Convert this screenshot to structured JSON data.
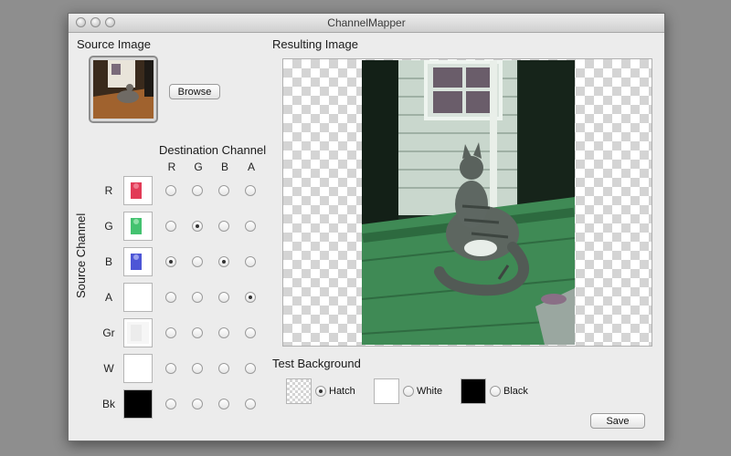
{
  "window": {
    "title": "ChannelMapper"
  },
  "source": {
    "label": "Source Image",
    "browse_label": "Browse"
  },
  "destination": {
    "label": "Destination Channel",
    "columns": [
      "R",
      "G",
      "B",
      "A"
    ]
  },
  "source_channel_label": "Source Channel",
  "rows": [
    {
      "label": "R",
      "swatch": "red-tint",
      "selected": [
        false,
        false,
        false,
        false
      ]
    },
    {
      "label": "G",
      "swatch": "green-tint",
      "selected": [
        false,
        true,
        false,
        false
      ]
    },
    {
      "label": "B",
      "swatch": "blue-tint",
      "selected": [
        true,
        false,
        true,
        false
      ]
    },
    {
      "label": "A",
      "swatch": "white",
      "selected": [
        false,
        false,
        false,
        true
      ]
    },
    {
      "label": "Gr",
      "swatch": "gray-faint",
      "selected": [
        false,
        false,
        false,
        false
      ]
    },
    {
      "label": "W",
      "swatch": "white",
      "selected": [
        false,
        false,
        false,
        false
      ]
    },
    {
      "label": "Bk",
      "swatch": "black",
      "selected": [
        false,
        false,
        false,
        false
      ]
    }
  ],
  "result": {
    "label": "Resulting Image"
  },
  "test_background": {
    "label": "Test Background",
    "options": [
      {
        "label": "Hatch",
        "selected": true
      },
      {
        "label": "White",
        "selected": false
      },
      {
        "label": "Black",
        "selected": false
      }
    ]
  },
  "save_label": "Save",
  "colors": {
    "window_bg": "#ececec",
    "desktop_bg": "#8e8e8e",
    "photo_tint": "#3f8a55"
  }
}
